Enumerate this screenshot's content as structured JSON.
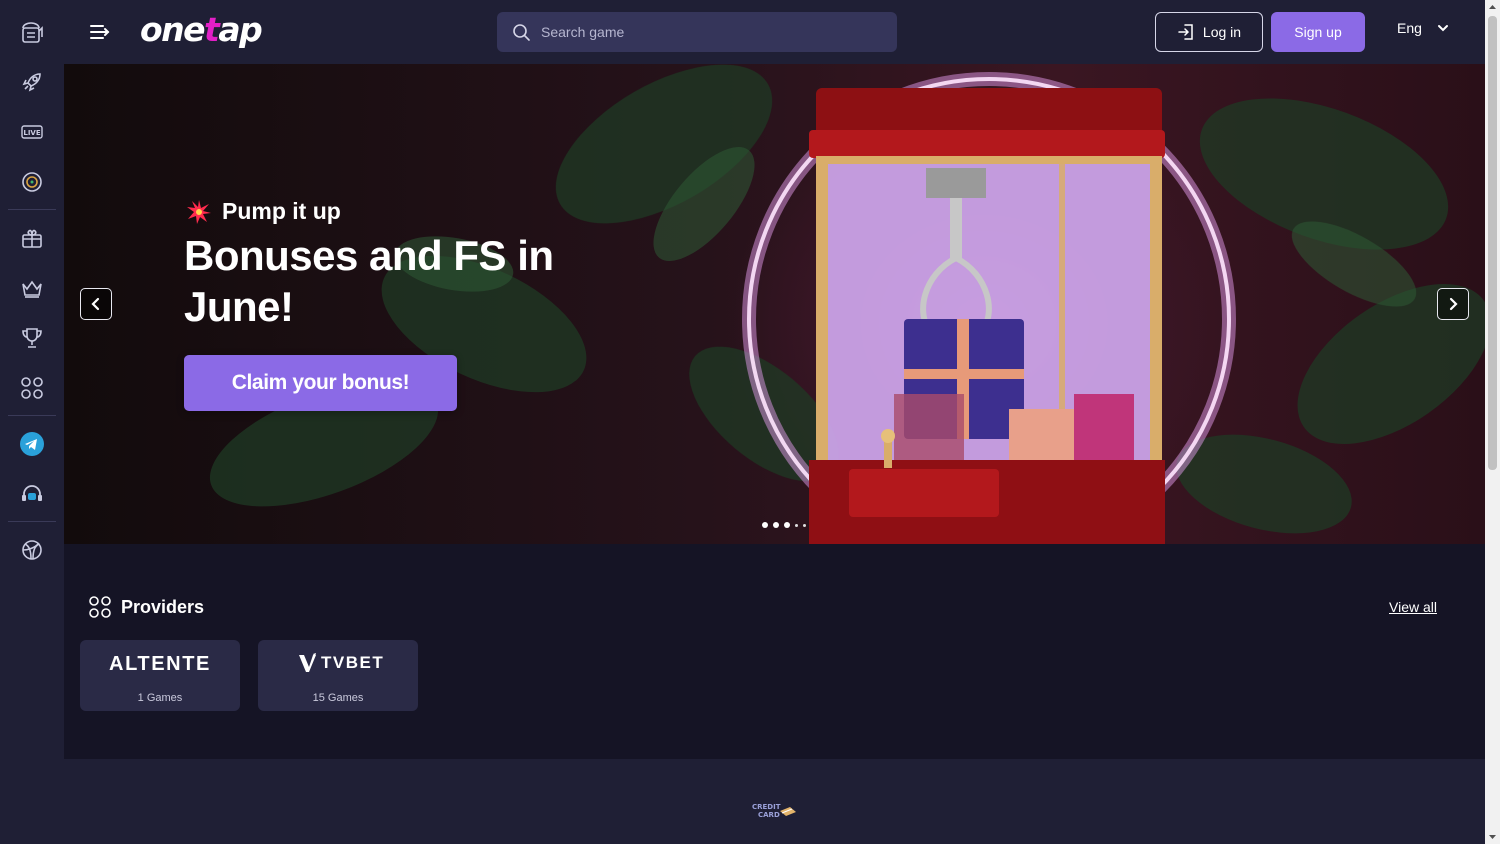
{
  "header": {
    "logo": {
      "part1": "one",
      "part2": "t",
      "part3": "ap"
    },
    "search_placeholder": "Search game",
    "login_label": "Log in",
    "signup_label": "Sign up",
    "language": "Eng"
  },
  "sidebar": {
    "items": [
      {
        "icon": "casino-icon"
      },
      {
        "icon": "rocket-icon"
      },
      {
        "icon": "live-icon"
      },
      {
        "icon": "roulette-icon"
      },
      {
        "icon": "gift-icon"
      },
      {
        "icon": "crown-icon"
      },
      {
        "icon": "trophy-icon"
      },
      {
        "icon": "grid-icon"
      },
      {
        "icon": "telegram-icon"
      },
      {
        "icon": "support-icon"
      },
      {
        "icon": "sports-ball-icon"
      }
    ]
  },
  "hero": {
    "kicker": "Pump it up",
    "title": "Bonuses and FS in June!",
    "cta_label": "Claim your bonus!",
    "slides_total": 5,
    "active_slide": 1
  },
  "providers": {
    "heading": "Providers",
    "view_all_label": "View all",
    "items": [
      {
        "name": "ALTENTE",
        "count": "1 Games"
      },
      {
        "name": "TVBET",
        "count": "15 Games"
      }
    ]
  },
  "footer": {
    "payment_logo": "CREDIT CARD"
  },
  "colors": {
    "background": "#1f1f35",
    "content_bg": "#151425",
    "accent": "#8b6ae6",
    "logo_accent": "#e21fc7",
    "telegram": "#2aa1da"
  }
}
